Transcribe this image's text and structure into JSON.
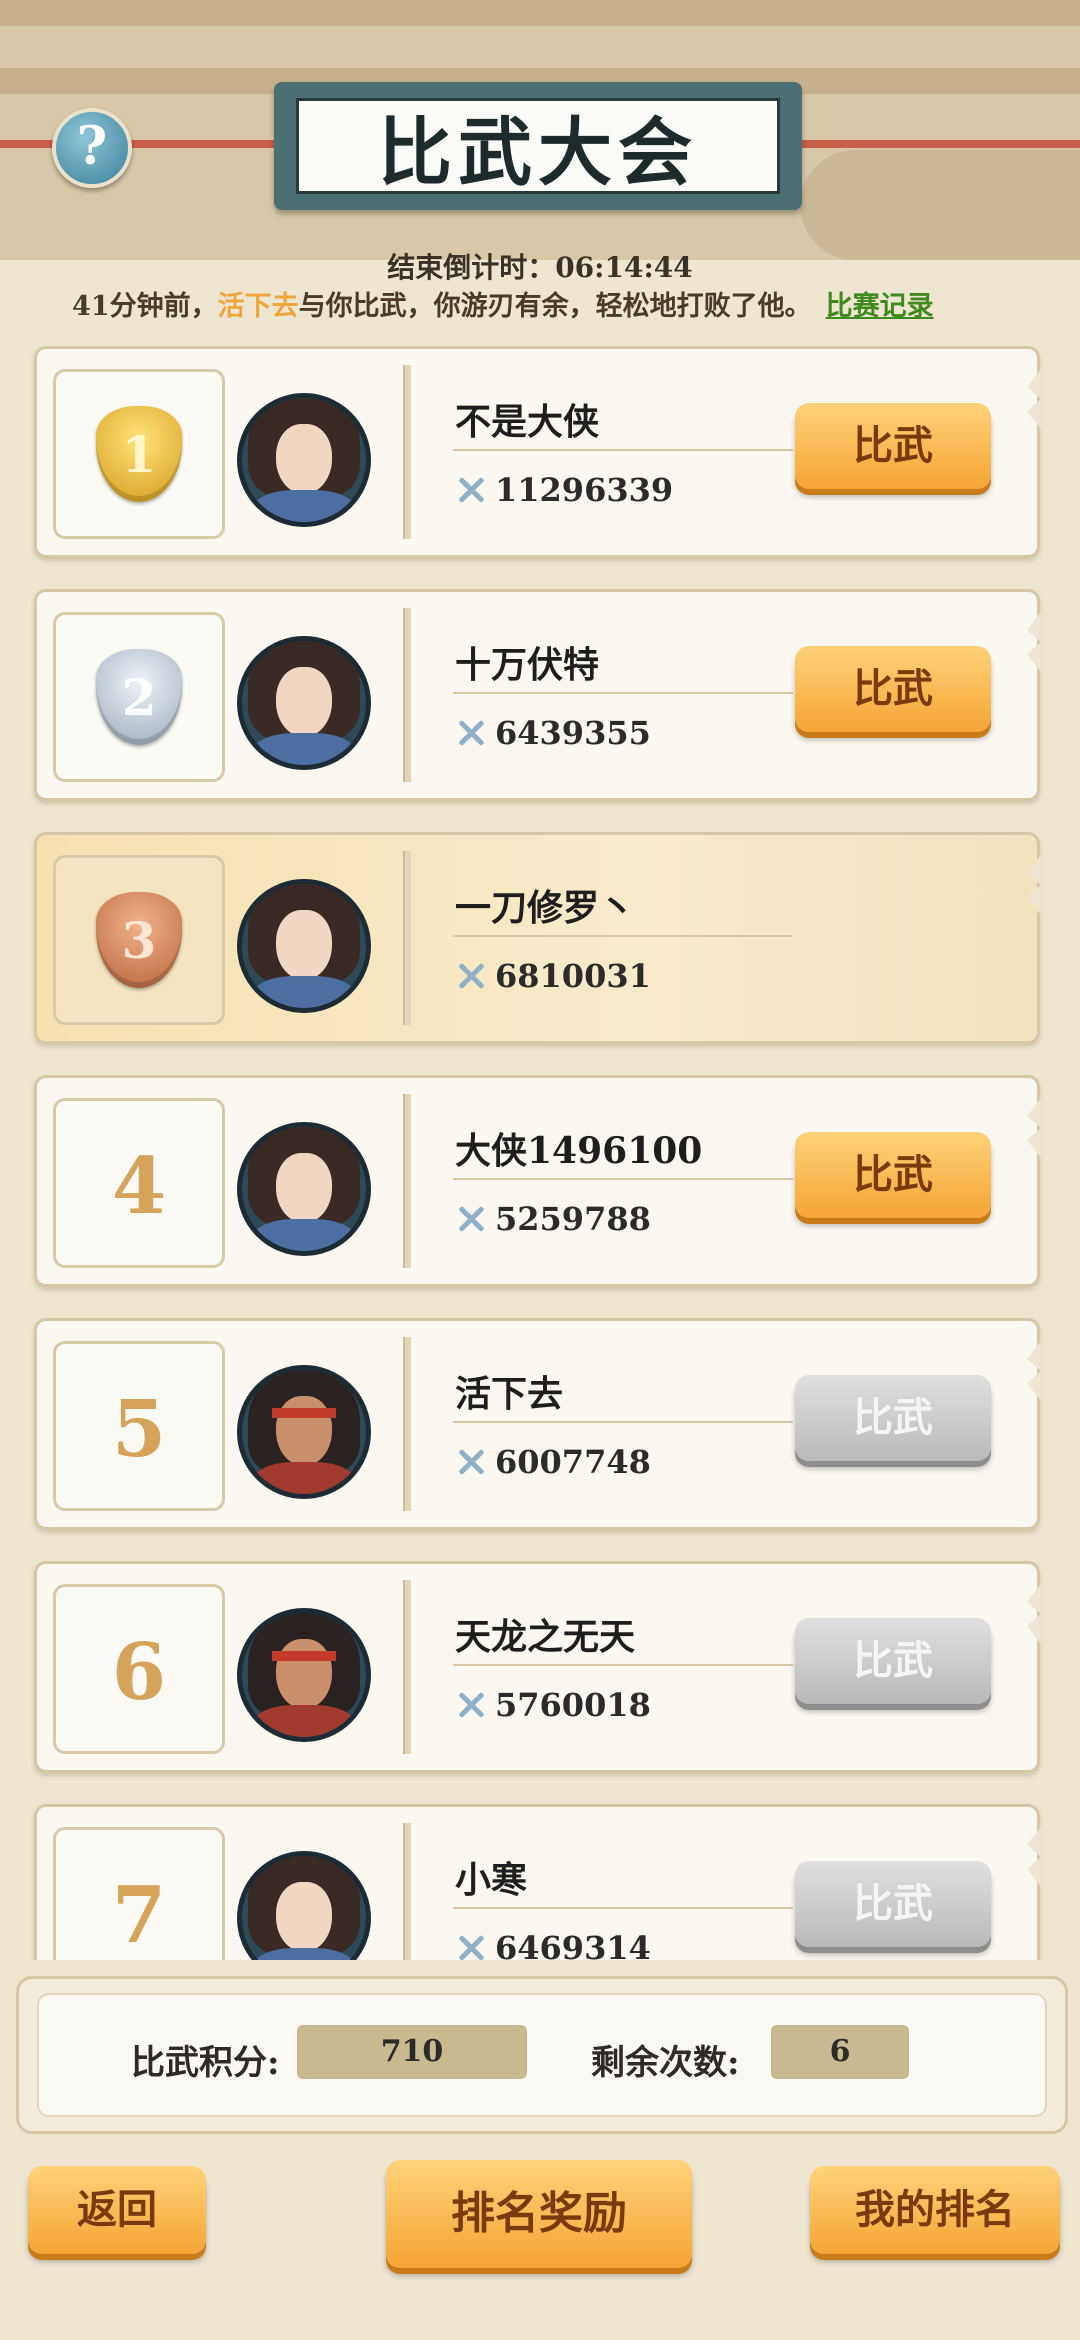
{
  "header": {
    "title": "比武大会",
    "countdown_label": "结束倒计时：06:14:44"
  },
  "news": {
    "prefix": "41分钟前，",
    "highlight_name": "活下去",
    "message": "与你比武，你游刃有余，轻松地打败了他。",
    "record_link": "比赛记录"
  },
  "ranking": [
    {
      "rank": "1",
      "medal": "gold",
      "name": "不是大侠",
      "power": "11296339",
      "button": "比武",
      "button_enabled": true
    },
    {
      "rank": "2",
      "medal": "silver",
      "name": "十万伏特",
      "power": "6439355",
      "button": "比武",
      "button_enabled": true
    },
    {
      "rank": "3",
      "medal": "bronze",
      "name": "一刀修罗丶",
      "power": "6810031",
      "button": "",
      "button_enabled": false,
      "is_me": true
    },
    {
      "rank": "4",
      "name": "大侠1496100",
      "power": "5259788",
      "button": "比武",
      "button_enabled": true
    },
    {
      "rank": "5",
      "name": "活下去",
      "power": "6007748",
      "button": "比武",
      "button_enabled": false
    },
    {
      "rank": "6",
      "name": "天龙之无天",
      "power": "5760018",
      "button": "比武",
      "button_enabled": false
    },
    {
      "rank": "7",
      "name": "小寒",
      "power": "6469314",
      "button": "比武",
      "button_enabled": false
    }
  ],
  "score": {
    "points_label": "比武积分:",
    "points_value": "710",
    "remaining_label": "剩余次数:",
    "remaining_value": "6"
  },
  "footer": {
    "back": "返回",
    "rank_reward": "排名奖励",
    "my_rank": "我的排名"
  },
  "colors": {
    "accent_orange": "#f5a534",
    "link_green": "#3f8a1c",
    "highlight_orange": "#f0a53a"
  }
}
